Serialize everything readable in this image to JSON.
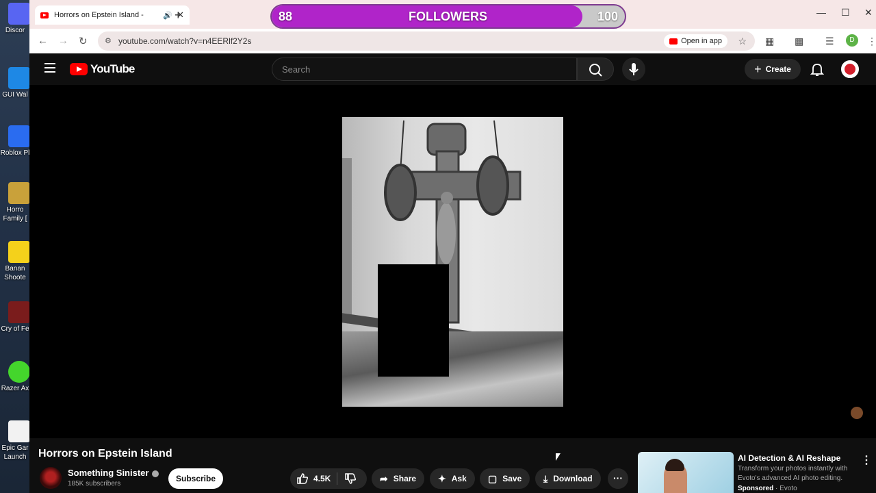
{
  "desktop": {
    "icons": [
      {
        "label": "Discor",
        "color": "#5865F2"
      },
      {
        "label": "GUI Wal",
        "color": "#1e88e5"
      },
      {
        "label": "Roblox Pl",
        "color": "#2a6cf0"
      },
      {
        "label": "Horro",
        "label2": "Family [",
        "color": "#c9a13a"
      },
      {
        "label": "Banan",
        "label2": "Shoote",
        "color": "#f4d11b"
      },
      {
        "label": "Cry of Fe",
        "color": "#7a1c1c"
      },
      {
        "label": "Razer Ax",
        "color": "#44d62c"
      },
      {
        "label": "Epic Gar",
        "label2": "Launch",
        "color": "#f2f2f2"
      }
    ]
  },
  "browser": {
    "tab_title": "Horrors on Epstein Island - ",
    "url": "youtube.com/watch?v=n4EERlf2Y2s",
    "open_in_app": "Open in app",
    "profile_initial": "D"
  },
  "followers": {
    "current": "88",
    "label": "FOLLOWERS",
    "goal": "100",
    "progress": 0.88,
    "color": "#b024c9"
  },
  "youtube": {
    "logo_text": "YouTube",
    "search_placeholder": "Search",
    "create_label": "Create"
  },
  "video": {
    "title": "Horrors on Epstein Island",
    "channel": "Something Sinister",
    "subscribers": "185K subscribers",
    "subscribe_label": "Subscribe",
    "likes": "4.5K",
    "share_label": "Share",
    "ask_label": "Ask",
    "save_label": "Save",
    "download_label": "Download"
  },
  "ad": {
    "title": "AI Detection & AI Reshape",
    "description": "Transform your photos instantly with Evoto's advanced AI photo editing.",
    "sponsored": "Sponsored",
    "advertiser": "Evoto"
  }
}
